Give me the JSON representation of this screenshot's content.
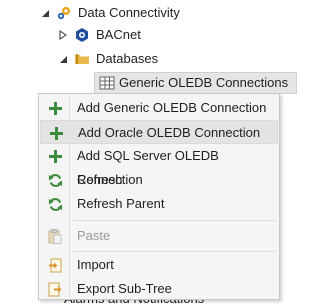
{
  "tree": {
    "data_connectivity": {
      "label": "Data Connectivity",
      "icon": "gear-cluster-icon"
    },
    "bacnet": {
      "label": "BACnet",
      "icon": "bacnet-icon"
    },
    "databases": {
      "label": "Databases",
      "icon": "folder-icon"
    },
    "generic_oledb": {
      "label": "Generic OLEDB Connections",
      "icon": "oledb-grid-icon"
    },
    "partial_hidden": {
      "label": "Alarms and Notifications"
    }
  },
  "menu": {
    "items": [
      {
        "label": "Add Generic OLEDB Connection",
        "icon": "plus-icon",
        "enabled": true
      },
      {
        "label": "Add Oracle OLEDB Connection",
        "icon": "plus-icon",
        "enabled": true,
        "highlighted": true
      },
      {
        "label": "Add SQL Server OLEDB Connection",
        "icon": "plus-icon",
        "enabled": true
      },
      {
        "label": "Refresh",
        "icon": "refresh-icon",
        "enabled": true
      },
      {
        "label": "Refresh Parent",
        "icon": "refresh-icon",
        "enabled": true
      },
      {
        "label": "Paste",
        "icon": "paste-icon",
        "enabled": false
      },
      {
        "label": "Import",
        "icon": "import-icon",
        "enabled": true
      },
      {
        "label": "Export Sub-Tree",
        "icon": "export-icon",
        "enabled": true
      }
    ]
  },
  "colors": {
    "plus": "#3c8c3c",
    "refresh": "#3c8c3c",
    "highlight": "#e3e3e3",
    "disabled_text": "#9a9a9a"
  }
}
